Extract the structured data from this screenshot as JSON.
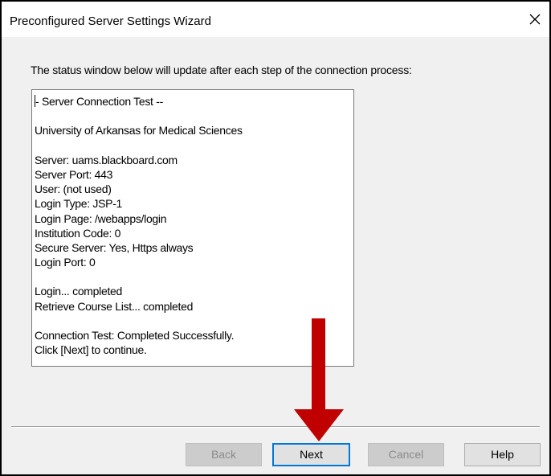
{
  "window": {
    "title": "Preconfigured Server Settings Wizard",
    "close_icon": "close-icon"
  },
  "instruction": "The status window below will update after each step of the connection process:",
  "status": {
    "lines": [
      "- Server Connection Test --",
      "",
      "University of Arkansas for Medical Sciences",
      "",
      "Server: uams.blackboard.com",
      "Server Port: 443",
      "User: (not used)",
      "Login Type: JSP-1",
      "Login Page: /webapps/login",
      "Institution Code: 0",
      "Secure Server: Yes, Https always",
      "Login Port: 0",
      "",
      "Login... completed",
      "Retrieve Course List... completed",
      "",
      "Connection Test: Completed Successfully.",
      "Click [Next] to continue."
    ]
  },
  "buttons": {
    "back": "Back",
    "next": "Next",
    "cancel": "Cancel",
    "help": "Help"
  },
  "annotation": {
    "icon": "down-arrow-icon",
    "color": "#c00000"
  }
}
